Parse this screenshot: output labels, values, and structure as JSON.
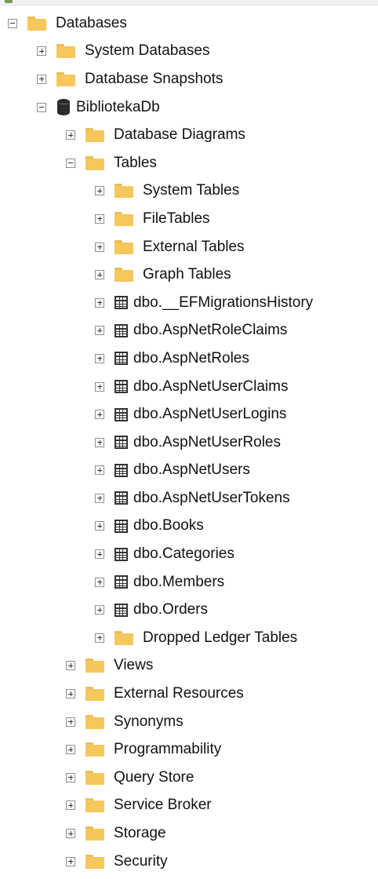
{
  "tree": {
    "nodes": [
      {
        "label": "Databases",
        "depth": 0,
        "expanded": true,
        "icon": "folder-icon"
      },
      {
        "label": "System Databases",
        "depth": 1,
        "expanded": false,
        "icon": "folder-icon"
      },
      {
        "label": "Database Snapshots",
        "depth": 1,
        "expanded": false,
        "icon": "folder-icon"
      },
      {
        "label": "BibliotekaDb",
        "depth": 1,
        "expanded": true,
        "icon": "database-icon"
      },
      {
        "label": "Database Diagrams",
        "depth": 2,
        "expanded": false,
        "icon": "folder-icon"
      },
      {
        "label": "Tables",
        "depth": 2,
        "expanded": true,
        "icon": "folder-icon"
      },
      {
        "label": "System Tables",
        "depth": 3,
        "expanded": false,
        "icon": "folder-icon"
      },
      {
        "label": "FileTables",
        "depth": 3,
        "expanded": false,
        "icon": "folder-icon"
      },
      {
        "label": "External Tables",
        "depth": 3,
        "expanded": false,
        "icon": "folder-icon"
      },
      {
        "label": "Graph Tables",
        "depth": 3,
        "expanded": false,
        "icon": "folder-icon"
      },
      {
        "label": "dbo.__EFMigrationsHistory",
        "depth": 3,
        "expanded": false,
        "icon": "table-icon"
      },
      {
        "label": "dbo.AspNetRoleClaims",
        "depth": 3,
        "expanded": false,
        "icon": "table-icon"
      },
      {
        "label": "dbo.AspNetRoles",
        "depth": 3,
        "expanded": false,
        "icon": "table-icon"
      },
      {
        "label": "dbo.AspNetUserClaims",
        "depth": 3,
        "expanded": false,
        "icon": "table-icon"
      },
      {
        "label": "dbo.AspNetUserLogins",
        "depth": 3,
        "expanded": false,
        "icon": "table-icon"
      },
      {
        "label": "dbo.AspNetUserRoles",
        "depth": 3,
        "expanded": false,
        "icon": "table-icon"
      },
      {
        "label": "dbo.AspNetUsers",
        "depth": 3,
        "expanded": false,
        "icon": "table-icon"
      },
      {
        "label": "dbo.AspNetUserTokens",
        "depth": 3,
        "expanded": false,
        "icon": "table-icon"
      },
      {
        "label": "dbo.Books",
        "depth": 3,
        "expanded": false,
        "icon": "table-icon"
      },
      {
        "label": "dbo.Categories",
        "depth": 3,
        "expanded": false,
        "icon": "table-icon"
      },
      {
        "label": "dbo.Members",
        "depth": 3,
        "expanded": false,
        "icon": "table-icon"
      },
      {
        "label": "dbo.Orders",
        "depth": 3,
        "expanded": false,
        "icon": "table-icon"
      },
      {
        "label": "Dropped Ledger Tables",
        "depth": 3,
        "expanded": false,
        "icon": "folder-icon"
      },
      {
        "label": "Views",
        "depth": 2,
        "expanded": false,
        "icon": "folder-icon"
      },
      {
        "label": "External Resources",
        "depth": 2,
        "expanded": false,
        "icon": "folder-icon"
      },
      {
        "label": "Synonyms",
        "depth": 2,
        "expanded": false,
        "icon": "folder-icon"
      },
      {
        "label": "Programmability",
        "depth": 2,
        "expanded": false,
        "icon": "folder-icon"
      },
      {
        "label": "Query Store",
        "depth": 2,
        "expanded": false,
        "icon": "folder-icon"
      },
      {
        "label": "Service Broker",
        "depth": 2,
        "expanded": false,
        "icon": "folder-icon"
      },
      {
        "label": "Storage",
        "depth": 2,
        "expanded": false,
        "icon": "folder-icon"
      },
      {
        "label": "Security",
        "depth": 2,
        "expanded": false,
        "icon": "folder-icon"
      }
    ]
  },
  "colors": {
    "folder": "#f5c75d",
    "folder_tab": "#e9bf5a",
    "toggle_border": "#8e8f8f",
    "text": "#111111",
    "background": "#ffffff"
  }
}
